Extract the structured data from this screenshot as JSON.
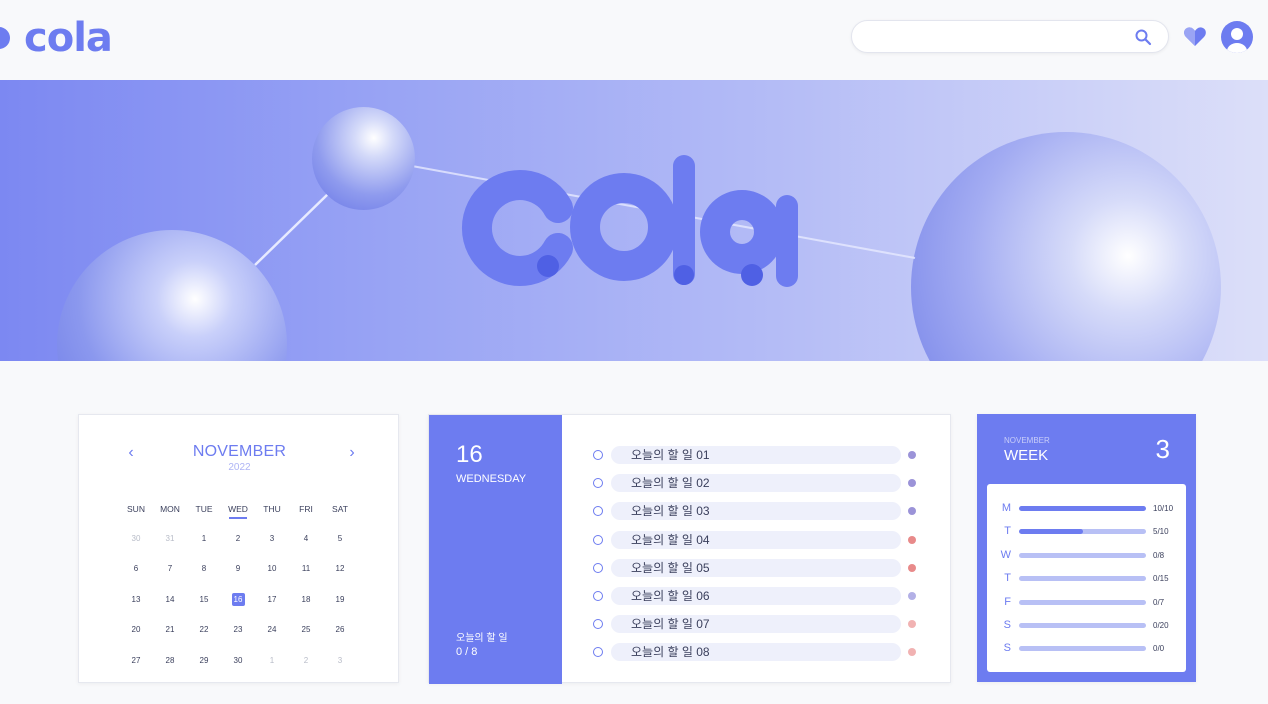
{
  "header": {
    "logo": "cola",
    "search_placeholder": "",
    "search_value": ""
  },
  "banner": {
    "title": "cola"
  },
  "calendar": {
    "month": "NOVEMBER",
    "year": "2022",
    "prev_icon": "chevron-left-icon",
    "next_icon": "chevron-right-icon",
    "weekdays": [
      "SUN",
      "MON",
      "TUE",
      "WED",
      "THU",
      "FRI",
      "SAT"
    ],
    "active_weekday": "WED",
    "weeks": [
      [
        "30",
        "31",
        "1",
        "2",
        "3",
        "4",
        "5"
      ],
      [
        "6",
        "7",
        "8",
        "9",
        "10",
        "11",
        "12"
      ],
      [
        "13",
        "14",
        "15",
        "16",
        "17",
        "18",
        "19"
      ],
      [
        "20",
        "21",
        "22",
        "23",
        "24",
        "25",
        "26"
      ],
      [
        "27",
        "28",
        "29",
        "30",
        "1",
        "2",
        "3"
      ]
    ],
    "today": "16"
  },
  "todo": {
    "day": "16",
    "weekday": "WEDNESDAY",
    "progress_label": "오늘의 할 일",
    "progress_value": "0 / 8",
    "items": [
      {
        "text": "오늘의 할 일 01",
        "color": "#9b93d8"
      },
      {
        "text": "오늘의 할 일 02",
        "color": "#9b93d8"
      },
      {
        "text": "오늘의 할 일 03",
        "color": "#9b93d8"
      },
      {
        "text": "오늘의 할 일 04",
        "color": "#e88a8a"
      },
      {
        "text": "오늘의 할 일 05",
        "color": "#e88a8a"
      },
      {
        "text": "오늘의 할 일 06",
        "color": "#b3b0e6"
      },
      {
        "text": "오늘의 할 일 07",
        "color": "#f1b2b2"
      },
      {
        "text": "오늘의 할 일 08",
        "color": "#f1b2b2"
      }
    ]
  },
  "week": {
    "month": "NOVEMBER",
    "title": "WEEK",
    "number": "3",
    "days": [
      {
        "letter": "M",
        "done": 10,
        "total": 10,
        "count": "10/10"
      },
      {
        "letter": "T",
        "done": 5,
        "total": 10,
        "count": "5/10"
      },
      {
        "letter": "W",
        "done": 0,
        "total": 8,
        "count": "0/8"
      },
      {
        "letter": "T",
        "done": 0,
        "total": 15,
        "count": "0/15"
      },
      {
        "letter": "F",
        "done": 0,
        "total": 7,
        "count": "0/7"
      },
      {
        "letter": "S",
        "done": 0,
        "total": 20,
        "count": "0/20"
      },
      {
        "letter": "S",
        "done": 0,
        "total": 0,
        "count": "0/0"
      }
    ]
  }
}
